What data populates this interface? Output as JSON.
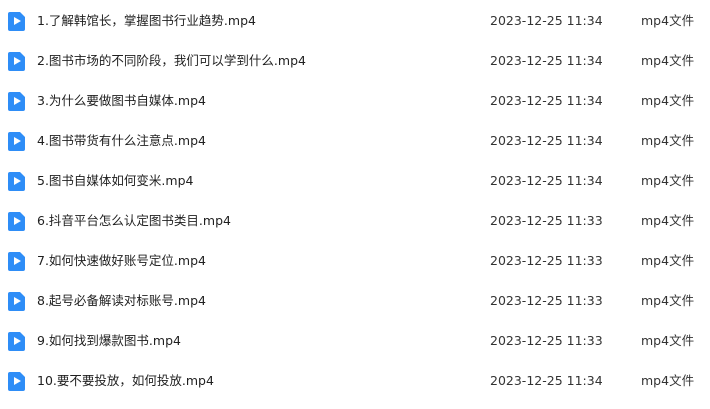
{
  "colors": {
    "video_icon": "#2e8df7"
  },
  "files": [
    {
      "name": "1.了解韩馆长，掌握图书行业趋势.mp4",
      "modified": "2023-12-25 11:34",
      "type": "mp4文件",
      "icon": "video-file-icon"
    },
    {
      "name": "2.图书市场的不同阶段，我们可以学到什么.mp4",
      "modified": "2023-12-25 11:34",
      "type": "mp4文件",
      "icon": "video-file-icon"
    },
    {
      "name": "3.为什么要做图书自媒体.mp4",
      "modified": "2023-12-25 11:34",
      "type": "mp4文件",
      "icon": "video-file-icon"
    },
    {
      "name": "4.图书带货有什么注意点.mp4",
      "modified": "2023-12-25 11:34",
      "type": "mp4文件",
      "icon": "video-file-icon"
    },
    {
      "name": "5.图书自媒体如何变米.mp4",
      "modified": "2023-12-25 11:34",
      "type": "mp4文件",
      "icon": "video-file-icon"
    },
    {
      "name": "6.抖音平台怎么认定图书类目.mp4",
      "modified": "2023-12-25 11:33",
      "type": "mp4文件",
      "icon": "video-file-icon"
    },
    {
      "name": "7.如何快速做好账号定位.mp4",
      "modified": "2023-12-25 11:33",
      "type": "mp4文件",
      "icon": "video-file-icon"
    },
    {
      "name": "8.起号必备解读对标账号.mp4",
      "modified": "2023-12-25 11:33",
      "type": "mp4文件",
      "icon": "video-file-icon"
    },
    {
      "name": "9.如何找到爆款图书.mp4",
      "modified": "2023-12-25 11:33",
      "type": "mp4文件",
      "icon": "video-file-icon"
    },
    {
      "name": "10.要不要投放，如何投放.mp4",
      "modified": "2023-12-25 11:34",
      "type": "mp4文件",
      "icon": "video-file-icon"
    }
  ]
}
